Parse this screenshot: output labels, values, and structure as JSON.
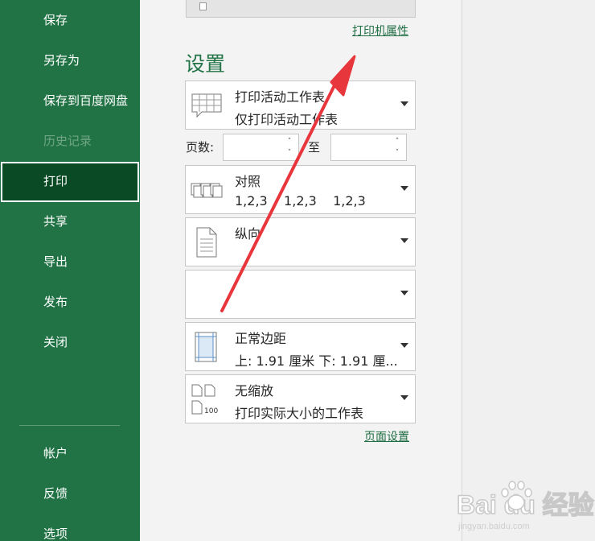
{
  "sidebar": {
    "items": [
      {
        "label": "保存",
        "state": "normal"
      },
      {
        "label": "另存为",
        "state": "normal"
      },
      {
        "label": "保存到百度网盘",
        "state": "normal"
      },
      {
        "label": "历史记录",
        "state": "disabled"
      },
      {
        "label": "打印",
        "state": "active"
      },
      {
        "label": "共享",
        "state": "normal"
      },
      {
        "label": "导出",
        "state": "normal"
      },
      {
        "label": "发布",
        "state": "normal"
      },
      {
        "label": "关闭",
        "state": "normal"
      }
    ],
    "bottom_items": [
      {
        "label": "帐户"
      },
      {
        "label": "反馈"
      },
      {
        "label": "选项"
      }
    ]
  },
  "printer": {
    "properties_link": "打印机属性"
  },
  "settings": {
    "title": "设置",
    "print_what": {
      "main": "打印活动工作表",
      "sub": "仅打印活动工作表"
    },
    "pages": {
      "label": "页数:",
      "from_value": "",
      "to_label": "至",
      "to_value": ""
    },
    "collation": {
      "main": "对照",
      "sub": "1,2,3    1,2,3    1,2,3"
    },
    "orientation": {
      "main": "纵向"
    },
    "paper_size": {
      "main": ""
    },
    "margins": {
      "main": "正常边距",
      "sub": "上: 1.91 厘米 下: 1.91 厘..."
    },
    "scaling": {
      "main": "无缩放",
      "sub": "打印实际大小的工作表"
    },
    "page_setup_link": "页面设置"
  },
  "watermark": {
    "brand": "Bai du 经验",
    "url": "jingyan.baidu.com"
  },
  "colors": {
    "sidebar": "#217346",
    "active": "#0a4a24",
    "accent": "#217346",
    "arrow": "#e8363d"
  }
}
